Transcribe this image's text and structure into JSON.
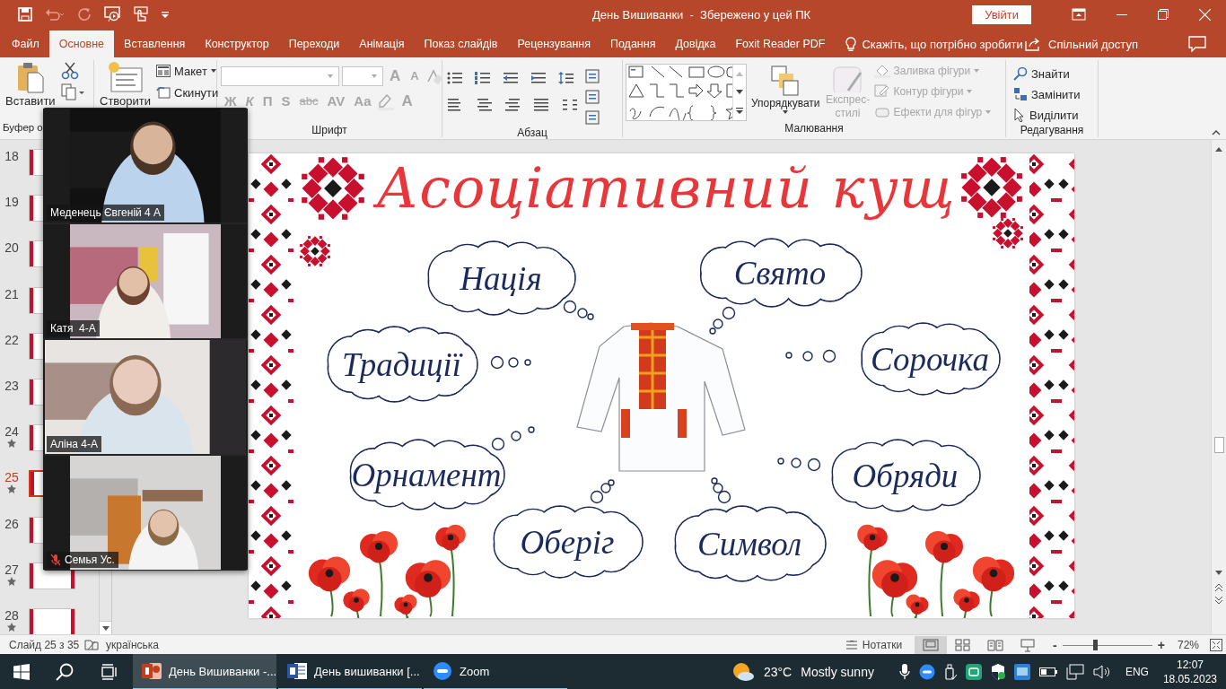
{
  "window": {
    "title": "День Вишиванки  -  Збережено у цей ПК",
    "sign_in": "Увійти"
  },
  "tabs": [
    {
      "label": "Файл",
      "selected": false
    },
    {
      "label": "Основне",
      "selected": true
    },
    {
      "label": "Вставлення",
      "selected": false
    },
    {
      "label": "Конструктор",
      "selected": false
    },
    {
      "label": "Переходи",
      "selected": false
    },
    {
      "label": "Анімація",
      "selected": false
    },
    {
      "label": "Показ слайдів",
      "selected": false
    },
    {
      "label": "Рецензування",
      "selected": false
    },
    {
      "label": "Подання",
      "selected": false
    },
    {
      "label": "Довідка",
      "selected": false
    },
    {
      "label": "Foxit Reader PDF",
      "selected": false
    }
  ],
  "tell_me": "Скажіть, що потрібно зробити",
  "share": "Спільний доступ",
  "ribbon": {
    "clipboard": {
      "paste": "Вставити",
      "label": "Буфер о"
    },
    "slides": {
      "new": "Створити",
      "layout": "Макет",
      "reset": "Скинути"
    },
    "font": {
      "label": "Шрифт",
      "disabled": true,
      "grow": "A",
      "shrink": "A",
      "buttons": [
        "Ж",
        "К",
        "П",
        "S",
        "abc",
        "AV",
        "Aa"
      ],
      "color_letter": "A"
    },
    "paragraph": {
      "label": "Абзац"
    },
    "drawing": {
      "label": "Малювання",
      "arrange": "Упорядкувати",
      "quick_styles": {
        "label": "Експрес-стилі",
        "disabled": true
      },
      "commands": [
        {
          "label": "Заливка фігури",
          "disabled": true
        },
        {
          "label": "Контур фігури",
          "disabled": true
        },
        {
          "label": "Ефекти для фігур",
          "disabled": true
        }
      ]
    },
    "editing": {
      "label": "Редагування",
      "commands": [
        {
          "label": "Знайти"
        },
        {
          "label": "Замінити"
        },
        {
          "label": "Виділити"
        }
      ]
    }
  },
  "slide_panel": [
    {
      "number": "18",
      "starred": false,
      "selected": false
    },
    {
      "number": "19",
      "starred": false,
      "selected": false
    },
    {
      "number": "20",
      "starred": false,
      "selected": false
    },
    {
      "number": "21",
      "starred": false,
      "selected": false
    },
    {
      "number": "22",
      "starred": false,
      "selected": false
    },
    {
      "number": "23",
      "starred": false,
      "selected": false
    },
    {
      "number": "24",
      "starred": true,
      "selected": false
    },
    {
      "number": "25",
      "starred": true,
      "selected": true
    },
    {
      "number": "26",
      "starred": false,
      "selected": false
    },
    {
      "number": "27",
      "starred": true,
      "selected": false
    },
    {
      "number": "28",
      "starred": true,
      "selected": false
    }
  ],
  "slide": {
    "title": "Асоціативний кущ",
    "bubbles": [
      "Нація",
      "Свято",
      "Традиції",
      "Сорочка",
      "Орнамент",
      "Обряди",
      "Оберіг",
      "Символ"
    ]
  },
  "video_panel": [
    {
      "name": "Меденець Євгеній 4 А",
      "muted": false
    },
    {
      "name": "Катя  4-А",
      "muted": false
    },
    {
      "name": "Аліна 4-А",
      "muted": false
    },
    {
      "name": "Семья Ус.",
      "muted": true
    }
  ],
  "status_bar": {
    "slide_info": "Слайд 25 з 35",
    "language": "українська",
    "notes": "Нотатки",
    "views": [
      {
        "kind": "normal",
        "selected": true
      },
      {
        "kind": "sorter",
        "selected": false
      },
      {
        "kind": "reading",
        "selected": false
      },
      {
        "kind": "slideshow",
        "selected": false
      }
    ],
    "zoom_out": "-",
    "zoom_in": "+",
    "zoom": {
      "level": 0.36
    },
    "zoom_percent": "72%"
  },
  "taskbar": {
    "apps": [
      {
        "kind": "powerpoint",
        "label": "День Вишиванки -...",
        "selected": true
      },
      {
        "kind": "word",
        "label": "День вишиванки [...",
        "selected": false
      },
      {
        "kind": "zoom",
        "label": "Zoom",
        "selected": false
      }
    ],
    "weather": {
      "temperature": "23°C",
      "condition": "Mostly sunny"
    },
    "language": "ENG",
    "time": "12:07",
    "date": "18.05.2023"
  }
}
